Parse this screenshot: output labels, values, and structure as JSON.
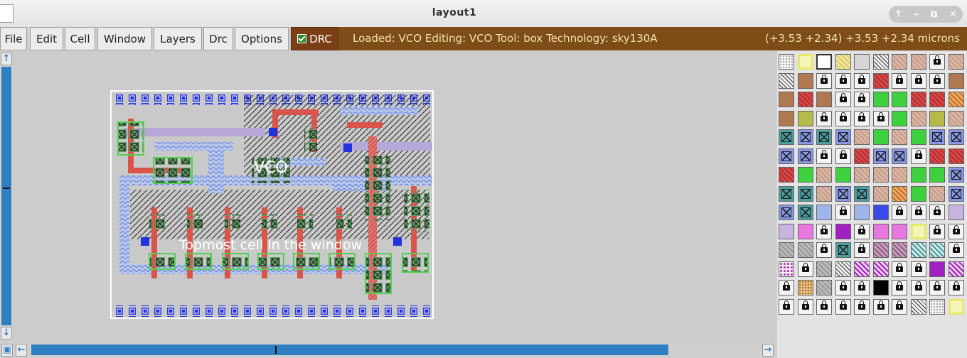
{
  "window": {
    "title": "layout1",
    "controls": [
      "↑",
      "–",
      "⧉",
      "✕"
    ]
  },
  "menu": [
    "File",
    "Edit",
    "Cell",
    "Window",
    "Layers",
    "Drc",
    "Options"
  ],
  "drc": {
    "label": "DRC",
    "checked": true
  },
  "status": {
    "text": "Loaded: VCO Editing: VCO Tool: box  Technology: sky130A",
    "coords": "(+3.53 +2.34) +3.53 +2.34 microns"
  },
  "layout": {
    "cell_label": "VCO",
    "window_caption": "Topmost cell in the window"
  },
  "colors": {
    "status_bg": "#7e4c17",
    "drc_bg": "#7c3e17",
    "scroll": "#2f7fc3"
  },
  "layer_palette": [
    [
      "dots",
      "yellow",
      "box",
      "ydiag",
      "plain",
      "bdiag",
      "tan",
      "tan",
      "lock",
      "tan"
    ],
    [
      "bdiag",
      "brown",
      "lock",
      "lock",
      "lock",
      "red",
      "lock",
      "lock",
      "lock",
      "brown"
    ],
    [
      "brown",
      "red",
      "brown",
      "lock",
      "lock",
      "green",
      "green",
      "red",
      "red",
      "orange"
    ],
    [
      "brown",
      "olive",
      "lock",
      "lock",
      "lock",
      "lock",
      "green",
      "tan",
      "olive",
      "tan"
    ],
    [
      "cx",
      "bx",
      "cx",
      "bx",
      "tan",
      "green",
      "tan",
      "green",
      "bx",
      "bx"
    ],
    [
      "bx",
      "bx",
      "lock",
      "lock",
      "red",
      "bx",
      "bx",
      "lock",
      "red",
      "red"
    ],
    [
      "red",
      "green",
      "tan",
      "green",
      "tan",
      "tan",
      "tan",
      "green",
      "green",
      "bx"
    ],
    [
      "cx",
      "cx",
      "tan",
      "bx",
      "cx",
      "tan",
      "orange",
      "green",
      "tan",
      "bx"
    ],
    [
      "bx",
      "cx",
      "lightblue",
      "lock",
      "lightblue",
      "blue",
      "lock",
      "lock",
      "lock",
      "lav"
    ],
    [
      "lav",
      "pink",
      "lock",
      "purple",
      "lock",
      "pink",
      "pink",
      "yellow",
      "lock",
      "lock"
    ],
    [
      "grey",
      "grey",
      "lock",
      "cx",
      "lock",
      "mauve",
      "mauve",
      "cyan",
      "cyan",
      "lock"
    ],
    [
      "pinkdots",
      "lock",
      "grey",
      "bdiag",
      "purplediag",
      "purplediag",
      "lock",
      "lock",
      "purple",
      "purplediag"
    ],
    [
      "lock",
      "gold",
      "grey",
      "lock",
      "lock",
      "black",
      "lock",
      "lock",
      "lock",
      "lock"
    ],
    [
      "lock",
      "lock",
      "lock",
      "lock",
      "lock",
      "lock",
      "lock",
      "bdiag",
      "dots",
      "yellow"
    ]
  ]
}
